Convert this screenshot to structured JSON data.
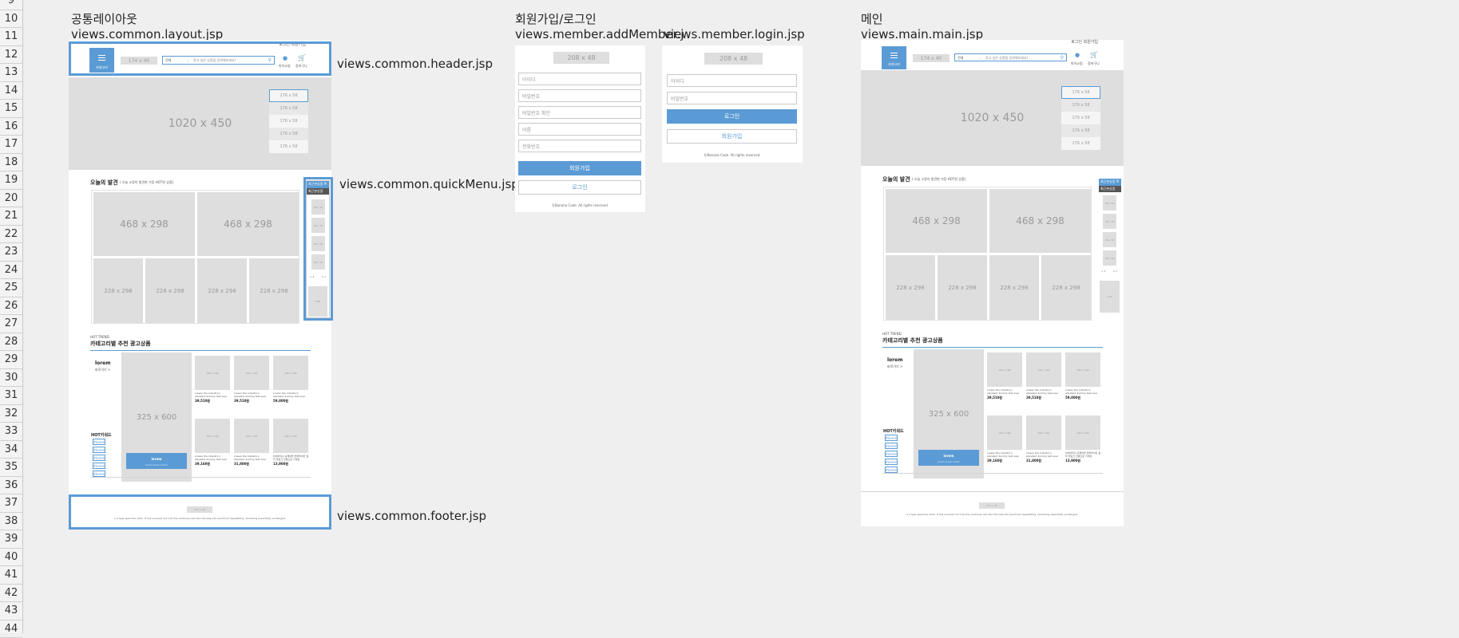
{
  "rows": [
    "9",
    "10",
    "11",
    "12",
    "13",
    "14",
    "15",
    "16",
    "17",
    "18",
    "19",
    "20",
    "21",
    "22",
    "23",
    "24",
    "25",
    "26",
    "27",
    "28",
    "29",
    "30",
    "31",
    "32",
    "33",
    "34",
    "35",
    "36",
    "37",
    "38",
    "39",
    "40",
    "41",
    "42",
    "43",
    "44"
  ],
  "sections": {
    "layout": {
      "title": "공통레이아웃",
      "file": "views.common.layout.jsp"
    },
    "member": {
      "title": "회원가입/로그인",
      "file_add": "views.member.addMember.j",
      "file_login": "views.member.login.jsp"
    },
    "main": {
      "title": "메인",
      "file": "views.main.main.jsp"
    }
  },
  "callouts": {
    "header": "views.common.header.jsp",
    "quickmenu": "views.common.quickMenu.jsp",
    "footer": "views.common.footer.jsp"
  },
  "mock": {
    "top_links": "로그인   회원가입",
    "menu_label": "카테고리",
    "logo_size": "174 x 40",
    "search_category": "전체",
    "search_placeholder": "찾고 싶은 상품을 검색해보세요!",
    "mypage_label": "마이쇼핑",
    "cart_label": "장바구니",
    "banner_size": "1020 x 450",
    "side_size": "176 x 58",
    "today_title": "오늘의 발견",
    "today_sub": "( 오늘 소량이 발견한 가장 HOT한 상품)",
    "big_size": "468 x 298",
    "small_size": "228 x 298",
    "quick_title": "최근본상품",
    "quick_btn": "최근본상품",
    "quick_item": "90 x 76",
    "quick_prev": "< 1",
    "quick_next": "1 >",
    "quick_top": "TOP",
    "hot_trend": "HOT TREND",
    "category_title": "카테고리별 추천 광고상품",
    "lorem": "lorem",
    "lorem_sub": "바로가기 >",
    "big_ad_size": "325 x 600",
    "ad_button": "lorem",
    "ad_button_sub": "lorem lorem lorem",
    "product_size": "160 x 160",
    "hot_keyword": "HOT키워드",
    "keyword": "#lorem",
    "product_desc": "s been the industry's standard dummy text ever",
    "product_desc_long": "아이라이너 홈케어블 블루라이트 필터 블링크 안경으로 가격은",
    "prices": [
      "39,510원",
      "39,510원",
      "59,800원",
      "39,160원",
      "31,800원",
      "13,900원"
    ],
    "footer_logo": "157 x 34",
    "footer_text": "a a type specimen book. It has survived not only five centuries, but also the leap into electronic typesetting, remaining essentially unchanged.",
    "login_logo": "208 x 48",
    "id_field": "아이디",
    "pw_field": "비밀번호",
    "pw_confirm": "비밀번호 확인",
    "name_field": "이름",
    "phone_field": "전화번호",
    "join_btn": "회원가입",
    "login_btn": "로그인",
    "copyright": "©Banana Code. All rights reserved."
  },
  "colors": {
    "accent": "#5b9bd5",
    "placeholder": "#dedede"
  }
}
